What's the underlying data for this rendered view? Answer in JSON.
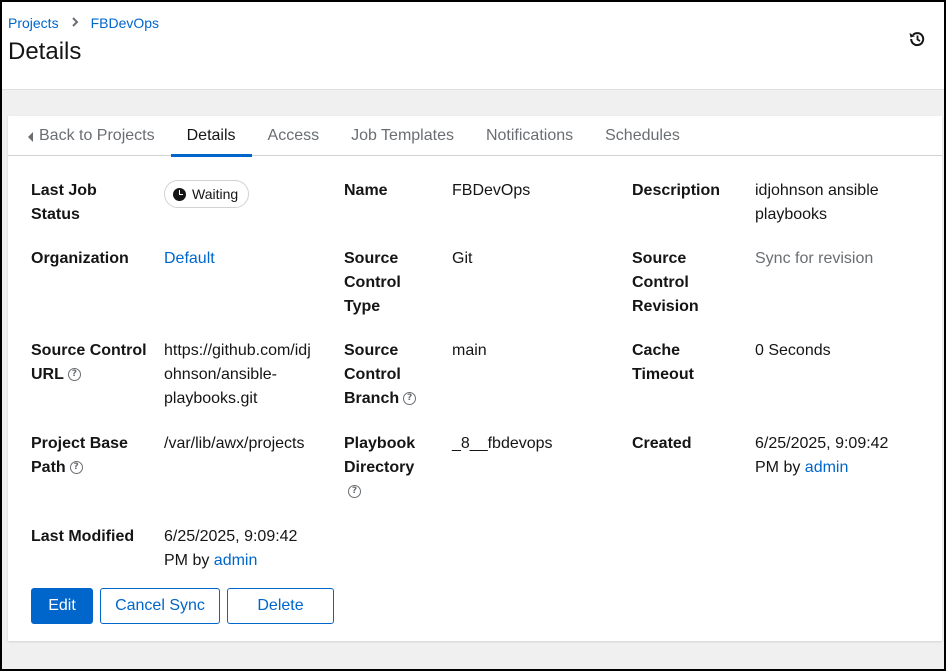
{
  "header": {
    "breadcrumb": [
      "Projects",
      "FBDevOps"
    ],
    "title": "Details",
    "history_icon": "history-icon"
  },
  "tabs": [
    {
      "label": "Back to Projects"
    },
    {
      "label": "Details"
    },
    {
      "label": "Access"
    },
    {
      "label": "Job Templates"
    },
    {
      "label": "Notifications"
    },
    {
      "label": "Schedules"
    }
  ],
  "details": {
    "last_job_status": {
      "label_line1": "Last Job",
      "label_line2": "Status",
      "value": "Waiting"
    },
    "name": {
      "label": "Name",
      "value": "FBDevOps"
    },
    "description": {
      "label": "Description",
      "value_line1": "idjohnson ansible",
      "value_line2": "playbooks"
    },
    "organization": {
      "label": "Organization",
      "value": "Default"
    },
    "source_control_type": {
      "label_line1": "Source",
      "label_line2": "Control",
      "label_line3": "Type",
      "value": "Git"
    },
    "source_control_revision": {
      "label_line1": "Source",
      "label_line2": "Control",
      "label_line3": "Revision",
      "value": "Sync for revision"
    },
    "source_control_url": {
      "label_line1": "Source Control",
      "label_line2": "URL",
      "value_line1": "https://github.com/idj",
      "value_line2": "ohnson/ansible-",
      "value_line3": "playbooks.git"
    },
    "source_control_branch": {
      "label_line1": "Source",
      "label_line2": "Control",
      "label_line3": "Branch",
      "value": "main"
    },
    "cache_timeout": {
      "label_line1": "Cache",
      "label_line2": "Timeout",
      "value": "0 Seconds"
    },
    "project_base_path": {
      "label_line1": "Project Base",
      "label_line2": "Path",
      "value": "/var/lib/awx/projects"
    },
    "playbook_directory": {
      "label_line1": "Playbook",
      "label_line2": "Directory",
      "value": "_8__fbdevops"
    },
    "created": {
      "label": "Created",
      "value_line1": "6/25/2025, 9:09:42",
      "value_line2_prefix": "PM by ",
      "user": "admin"
    },
    "last_modified": {
      "label": "Last Modified",
      "value_line1": "6/25/2025, 9:09:42",
      "value_line2_prefix": "PM by ",
      "user": "admin"
    }
  },
  "actions": {
    "edit": "Edit",
    "cancel_sync": "Cancel Sync",
    "delete": "Delete"
  },
  "help_glyph": "?"
}
